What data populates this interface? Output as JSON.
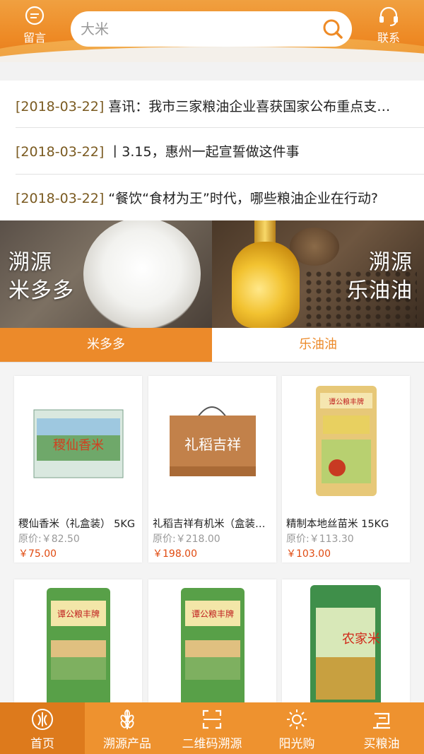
{
  "header": {
    "left_button": "留言",
    "right_button": "联系",
    "search_text": "大米"
  },
  "news": [
    {
      "date": "[2018-03-22]",
      "text": "喜讯：我市三家粮油企业喜获国家公布重点支…"
    },
    {
      "date": "[2018-03-22]",
      "text": "丨3.15，惠州一起宣誓做这件事"
    },
    {
      "date": "[2018-03-22]",
      "text": "“餐饮“食材为王”时代，哪些粮油企业在行动?"
    }
  ],
  "banner": {
    "left_line1": "溯源",
    "left_line2": "米多多",
    "right_line1": "溯源",
    "right_line2": "乐油油"
  },
  "tabs": [
    {
      "label": "米多多",
      "active": true
    },
    {
      "label": "乐油油",
      "active": false
    }
  ],
  "products": [
    {
      "name": "稷仙香米（礼盒装） 5KG",
      "original": "原价:￥82.50",
      "price": "￥75.00"
    },
    {
      "name": "礼稻吉祥有机米（盒装…",
      "original": "原价:￥218.00",
      "price": "￥198.00"
    },
    {
      "name": "精制本地丝苗米 15KG",
      "original": "原价:￥113.30",
      "price": "￥103.00"
    },
    {
      "name": "",
      "original": "",
      "price": ""
    },
    {
      "name": "",
      "original": "",
      "price": ""
    },
    {
      "name": "",
      "original": "",
      "price": ""
    }
  ],
  "product_images": {
    "p1_text": "稷仙香米",
    "p2_text": "礼稻吉祥",
    "p3_text": "谭公粮丰牌",
    "p4_text": "谭公粮丰牌",
    "p5_text": "谭公粮丰牌",
    "p6_text": "农家米"
  },
  "tabbar": [
    {
      "label": "首页",
      "icon": "leaf-logo-icon",
      "active": true
    },
    {
      "label": "溯源产品",
      "icon": "wheat-icon",
      "active": false
    },
    {
      "label": "二维码溯源",
      "icon": "scan-icon",
      "active": false
    },
    {
      "label": "阳光购",
      "icon": "sun-icon",
      "active": false
    },
    {
      "label": "买粮油",
      "icon": "shop-icon",
      "active": false
    }
  ],
  "colors": {
    "accent": "#ec8a2a",
    "price": "#e04a10",
    "date": "#7a5a20"
  }
}
